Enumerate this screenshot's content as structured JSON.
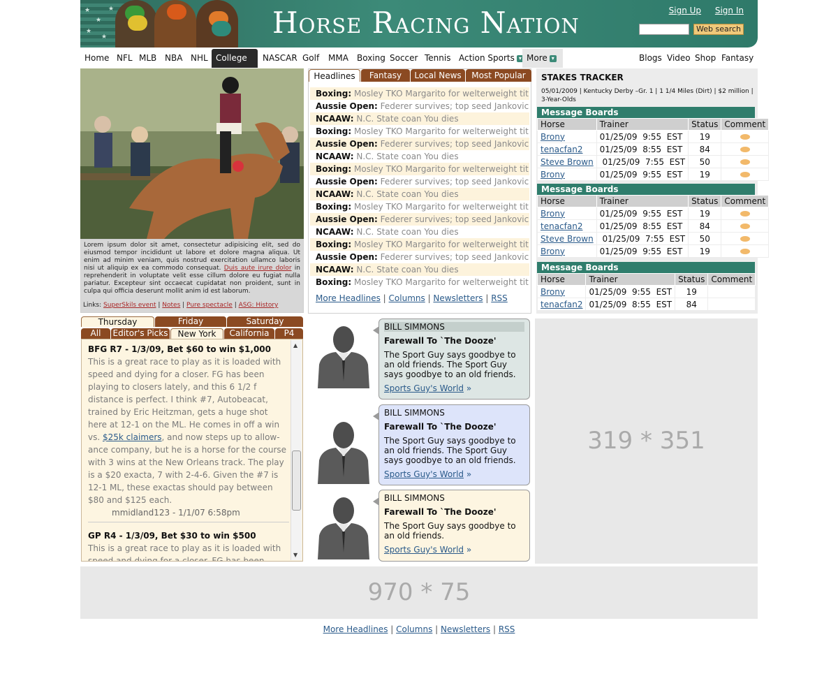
{
  "header": {
    "logo": "Horse Racing Nation",
    "sign_up": "Sign Up",
    "sign_in": "Sign In",
    "search_placeholder": "",
    "search_button": "Web search"
  },
  "nav": {
    "left": [
      "Home",
      "NFL",
      "MLB",
      "NBA",
      "NHL",
      "College",
      "NASCAR",
      "Golf",
      "MMA",
      "Boxing",
      "Soccer",
      "Tennis",
      "Action Sports",
      "More"
    ],
    "right": [
      "Blogs",
      "Video",
      "Shop",
      "Fantasy"
    ],
    "active": "College"
  },
  "photo": {
    "caption": "Lorem ipsum dolor sit amet, consectetur adipisicing elit, sed do eiusmod tempor incididunt ut labore et dolore magna aliqua. Ut enim ad minim veniam, quis nostrud exercitation ullamco laboris nisi ut aliquip ex ea commodo consequat.",
    "caption_link": "Duis aute irure dolor",
    "caption_tail": " in reprehenderit in voluptate velit esse cillum dolore eu fugiat nulla pariatur. Excepteur sint occaecat cupidatat non proident, sunt in culpa qui officia deserunt mollit anim id est laborum.",
    "links_label": "Links:",
    "links": [
      "SuperSkils event",
      "Notes",
      "Pure spectacle",
      "ASG: History"
    ]
  },
  "headlines": {
    "tabs": [
      "Headlines",
      "Fantasy",
      "Local News",
      "Most Popular"
    ],
    "items": [
      {
        "cat": "Boxing:",
        "text": "Mosley TKO Margarito for welterweight title"
      },
      {
        "cat": "Aussie Open:",
        "text": "Federer survives; top seed Jankovic out"
      },
      {
        "cat": "NCAAW:",
        "text": "N.C. State coan You dies"
      },
      {
        "cat": "Boxing:",
        "text": "Mosley TKO Margarito for welterweight title"
      },
      {
        "cat": "Aussie Open:",
        "text": "Federer survives; top seed Jankovic out"
      },
      {
        "cat": "NCAAW:",
        "text": "N.C. State coan You dies"
      },
      {
        "cat": "Boxing:",
        "text": "Mosley TKO Margarito for welterweight title"
      },
      {
        "cat": "Aussie Open:",
        "text": "Federer survives; top seed Jankovic out"
      },
      {
        "cat": "NCAAW:",
        "text": "N.C. State coan You dies"
      },
      {
        "cat": "Boxing:",
        "text": "Mosley TKO Margarito for welterweight title"
      },
      {
        "cat": "Aussie Open:",
        "text": "Federer survives; top seed Jankovic out"
      },
      {
        "cat": "NCAAW:",
        "text": "N.C. State coan You dies"
      },
      {
        "cat": "Boxing:",
        "text": "Mosley TKO Margarito for welterweight title"
      },
      {
        "cat": "Aussie Open:",
        "text": "Federer survives; top seed Jankovic out"
      },
      {
        "cat": "NCAAW:",
        "text": "N.C. State coan You dies"
      },
      {
        "cat": "Boxing:",
        "text": "Mosley TKO Margarito for welterweight title"
      }
    ],
    "footer": [
      "More Headlines",
      "Columns",
      "Newsletters",
      "RSS"
    ]
  },
  "stakes": {
    "title": "STAKES TRACKER",
    "info": "05/01/2009 | Kentucky Derby –Gr. 1 | 1 1/4 Miles (Dirt) | $2 million | 3-Year-Olds",
    "boards": [
      {
        "title": "Message Boards",
        "headers": [
          "Horse",
          "Trainer",
          "Status",
          "Comment"
        ],
        "rows": [
          {
            "horse": "Brony",
            "trainer": "01/25/09  9:55  EST",
            "status": "19",
            "comment": true
          },
          {
            "horse": "tenacfan2",
            "trainer": "01/25/09  8:55  EST",
            "status": "84",
            "comment": true
          },
          {
            "horse": "Steve Brown",
            "trainer": " 01/25/09  7:55  EST",
            "status": "50",
            "comment": true
          },
          {
            "horse": "Brony",
            "trainer": "01/25/09  9:55  EST",
            "status": "19",
            "comment": true
          }
        ]
      },
      {
        "title": "Message Boards",
        "headers": [
          "Horse",
          "Trainer",
          "Status",
          "Comment"
        ],
        "rows": [
          {
            "horse": "Brony",
            "trainer": "01/25/09  9:55  EST",
            "status": "19",
            "comment": true
          },
          {
            "horse": "tenacfan2",
            "trainer": "01/25/09  8:55  EST",
            "status": "84",
            "comment": true
          },
          {
            "horse": "Steve Brown",
            "trainer": " 01/25/09  7:55  EST",
            "status": "50",
            "comment": true
          },
          {
            "horse": "Brony",
            "trainer": "01/25/09  9:55  EST",
            "status": "19",
            "comment": true
          }
        ]
      },
      {
        "title": "Message Boards",
        "headers": [
          "Horse",
          "Trainer",
          "Status",
          "Comment"
        ],
        "rows": [
          {
            "horse": "Brony",
            "trainer": "01/25/09  9:55  EST",
            "status": "19",
            "comment": false
          },
          {
            "horse": "tenacfan2",
            "trainer": "01/25/09  8:55  EST",
            "status": "84",
            "comment": false
          }
        ]
      }
    ]
  },
  "picks": {
    "day_tabs": [
      "Thursday",
      "Friday",
      "Saturday"
    ],
    "filter_tabs": [
      "All",
      "Editor's Picks",
      "New York",
      "California",
      "P4"
    ],
    "entries": [
      {
        "title": "BFG R7 - 1/3/09, Bet $60 to win $1,000",
        "body_pre": "This is a great race to play as it is loaded with speed and dying for a closer.  FG has been playing to closers lately, and this 6 1/2 f distance is perfect.  I think #7, Autobeacat, trained by Eric Heitzman, gets a huge shot here at 12-1 on the ML.  He comes in off a win vs. ",
        "body_link": "$25k claimers",
        "body_post": ", and now steps up to allow-ance company, but he is a horse for the course with 3 wins at the New Orleans track.   The play is a $20 exacta, 7 with 2-4-6.  Given the  #7 is 12-1 ML, these exactas should pay between $80 and $125 each.",
        "meta": "mmidland123 - 1/1/07 6:58pm"
      },
      {
        "title": "GP R4 - 1/3/09, Bet $30 to win $500",
        "body_pre": "This is a great race to play as it is loaded with speed and dying for a closer.  FG has been playing to",
        "body_link": "",
        "body_post": "",
        "meta": ""
      }
    ]
  },
  "columnists": [
    {
      "author": "BILL SIMMONS",
      "headline": "Farewall To `The Dooze'",
      "desc": "The Sport Guy says goodbye to an old friends. The Sport Guy says goodbye to an old friends.",
      "link": "Sports Guy's  World",
      "bg": "#dde6e4"
    },
    {
      "author": "BILL SIMMONS",
      "headline": "Farewall To `The Dooze'",
      "desc": "The Sport Guy says goodbye to an old friends. The Sport Guy says goodbye to an old friends.",
      "link": "Sports Guy's  World",
      "bg": "#dde4fa"
    },
    {
      "author": "BILL SIMMONS",
      "headline": "Farewall To `The Dooze'",
      "desc": "The Sport Guy says goodbye to an old friends.",
      "link": "Sports Guy's  World",
      "bg": "#fdf5e1"
    }
  ],
  "ads": {
    "side": "319 * 351",
    "bottom": "970 * 75"
  },
  "footer": [
    "More Headlines",
    "Columns",
    "Newsletters",
    "RSS"
  ],
  "colors": {
    "brand": "#2f7d6c",
    "tab": "#8b4a22",
    "accent": "#f0c97a"
  }
}
